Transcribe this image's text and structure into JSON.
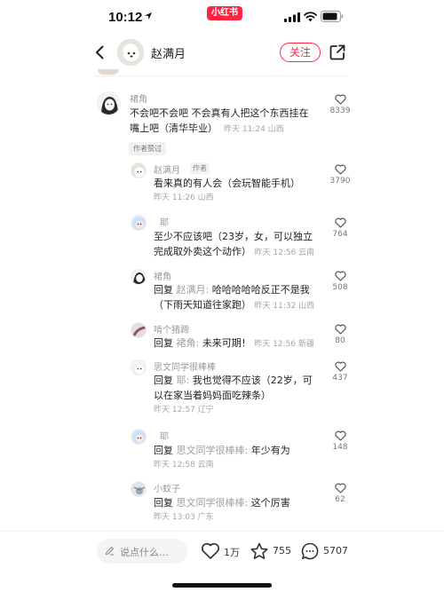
{
  "status_bar": {
    "time": "10:12",
    "app_badge": "小红书"
  },
  "header": {
    "author_name": "赵满月",
    "follow_label": "关注"
  },
  "comments": [
    {
      "user": "裙角",
      "line1": "不会吧不会吧  不会真有人把这个东西挂在",
      "line2": "嘴上吧（清华毕业）",
      "meta": "昨天 11:24 山西",
      "likes": "8339",
      "tag": "作者赞过"
    },
    {
      "user": "赵满月",
      "author_tag": "作者",
      "line1": "看来真的有人会（会玩智能手机）",
      "meta": "昨天 11:26 山西",
      "likes": "3790"
    },
    {
      "user": "耶",
      "line1": "至少不应该吧（23岁，女，可以独立",
      "line2": "完成取外卖这个动作）",
      "meta": "昨天 12:56 云南",
      "likes": "764"
    },
    {
      "user": "裙角",
      "reply_label": "回复",
      "reply_to": "赵满月:",
      "line1": " 哈哈哈哈哈反正不是我",
      "line2": "（下雨天知道往家跑）",
      "meta": "昨天 11:32 山西",
      "likes": "508"
    },
    {
      "user": "啃个猪蹄",
      "reply_label": "回复",
      "reply_to": "裙角:",
      "line1": " 未来可期！",
      "meta": "昨天 12:56 新疆",
      "likes": "80"
    },
    {
      "user": "思文同学很棒棒",
      "reply_label": "回复",
      "reply_to": "耶:",
      "line1": " 我也觉得不应该（22岁，可",
      "line2": "以在家当着妈妈面吃辣条）",
      "meta": "昨天 12:57 辽宁",
      "likes": "437"
    },
    {
      "user": "耶",
      "reply_label": "回复",
      "reply_to": "思文同学很棒棒:",
      "line1": " 年少有为",
      "meta": "昨天 12:58 云南",
      "likes": "148"
    },
    {
      "user": "小蚊子",
      "reply_label": "回复",
      "reply_to": "思文同学很棒棒:",
      "line1": " 这个厉害",
      "meta": "昨天 13:03 广东",
      "likes": "62"
    }
  ],
  "bottom_bar": {
    "input_placeholder": "说点什么...",
    "likes": "1万",
    "stars": "755",
    "comments": "5707"
  },
  "colors": {
    "brand": "#ff2442"
  }
}
